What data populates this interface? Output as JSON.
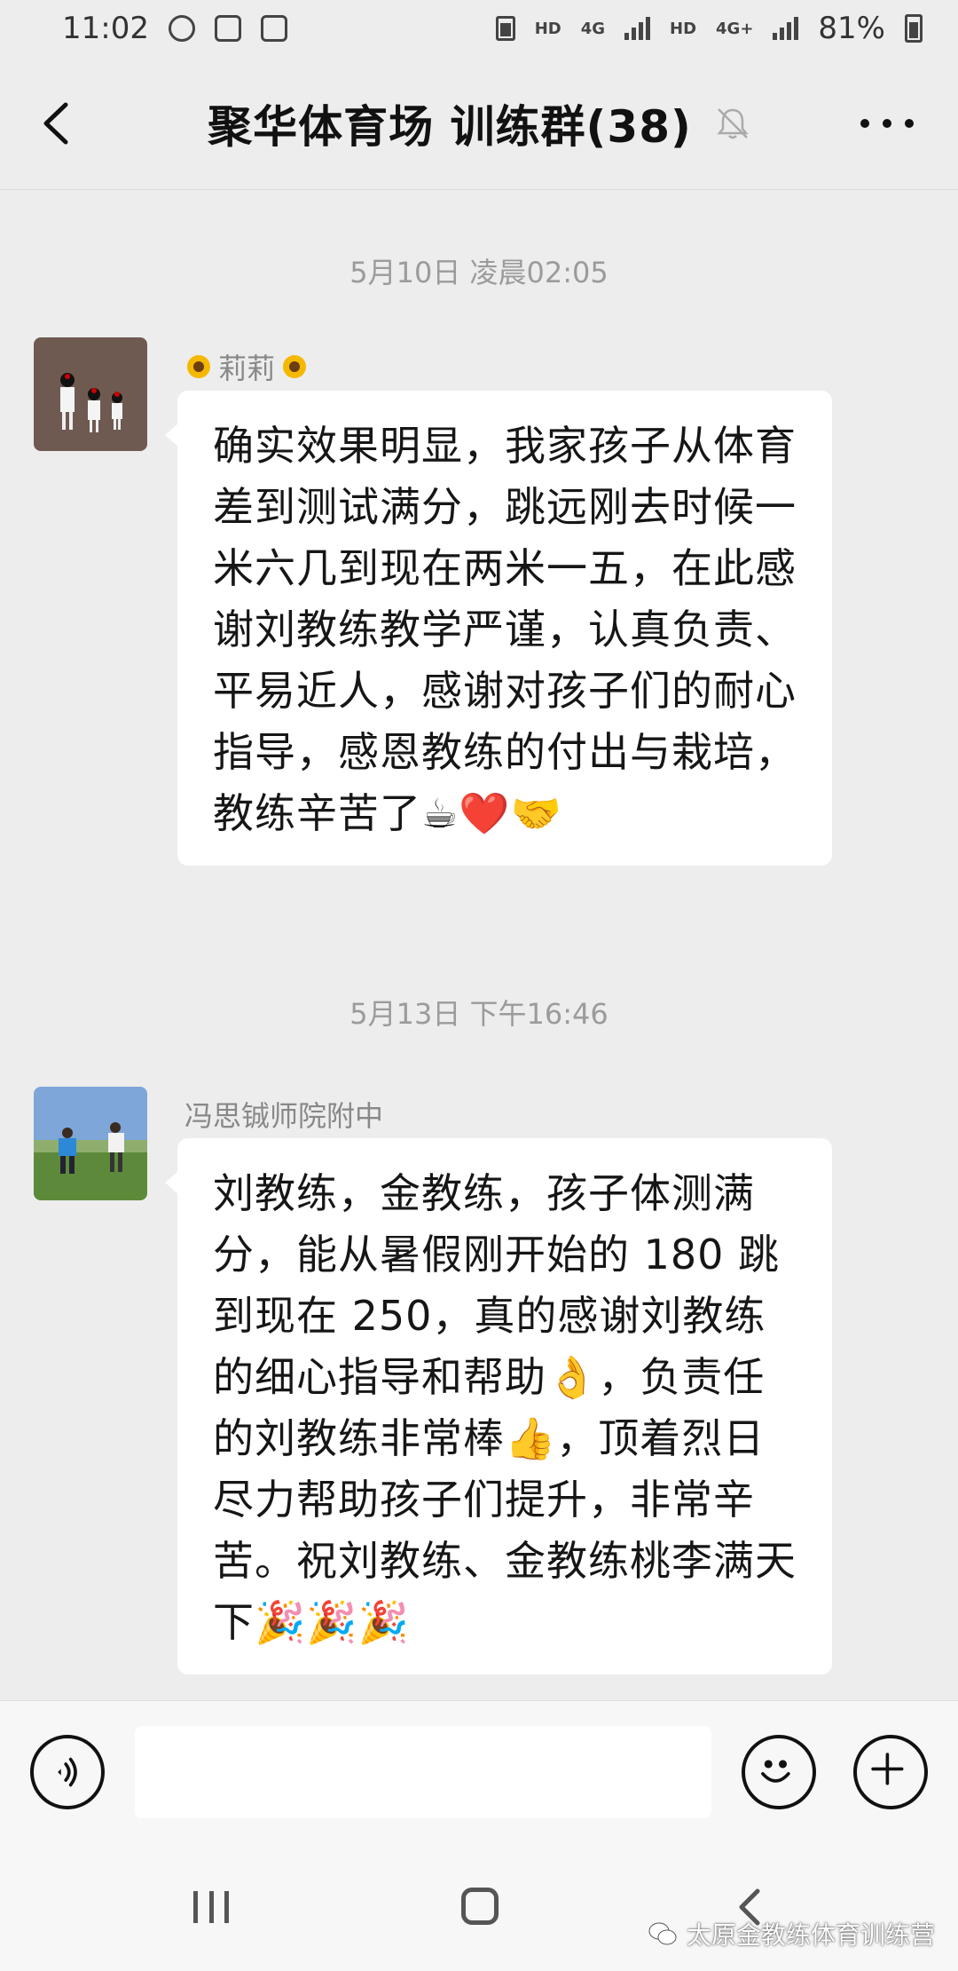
{
  "status_bar": {
    "time": "11:02",
    "hd1": "HD",
    "net1": "4G",
    "hd2": "HD",
    "net2": "4G+",
    "battery": "81%"
  },
  "nav": {
    "title": "聚华体育场  训练群(38)"
  },
  "messages": [
    {
      "timestamp": "5月10日 凌晨02:05",
      "sender": "莉莉",
      "text": "确实效果明显，我家孩子从体育差到测试满分，跳远刚去时候一米六几到现在两米一五，在此感谢刘教练教学严谨，认真负责、平易近人，感谢对孩子们的耐心指导，感恩教练的付出与栽培，教练辛苦了☕❤️🤝"
    },
    {
      "timestamp": "5月13日 下午16:46",
      "sender": "冯思铖师院附中",
      "text": "刘教练，金教练，孩子体测满分，能从暑假刚开始的 180 跳到现在 250，真的感谢刘教练的细心指导和帮助👌，负责任的刘教练非常棒👍，顶着烈日尽力帮助孩子们提升，非常辛苦。祝刘教练、金教练桃李满天下🎉🎉🎉"
    }
  ],
  "watermark": "太原金教练体育训练营"
}
